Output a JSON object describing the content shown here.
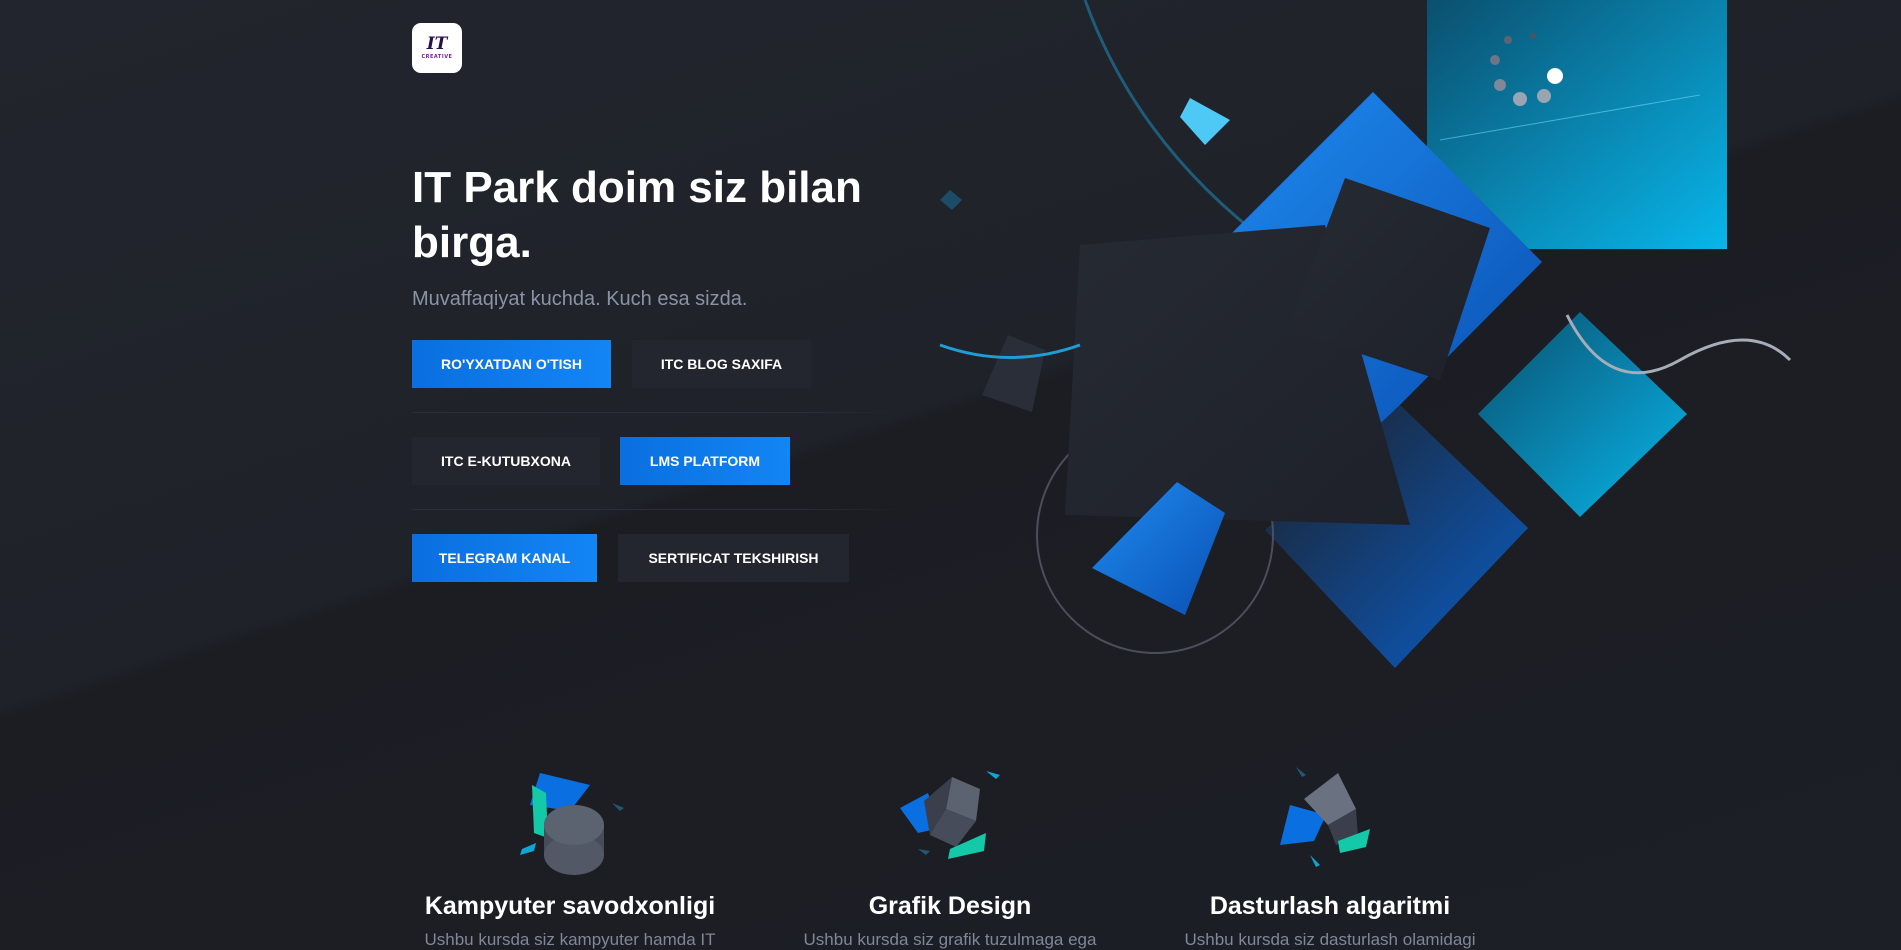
{
  "logo": {
    "mark": "IT",
    "word": "CREATIVE"
  },
  "hero": {
    "title": "IT Park doim siz bilan birga.",
    "subtitle": "Muvaffaqiyat kuchda. Kuch esa sizda."
  },
  "buttons": {
    "register": "RO'YXATDAN O'TISH",
    "blog": "ITC BLOG SAXIFA",
    "library": "ITC E-KUTUBXONA",
    "lms": "LMS PLATFORM",
    "telegram": "TELEGRAM KANAL",
    "certificate": "SERTIFICAT TEKSHIRISH"
  },
  "courses": [
    {
      "title": "Kampyuter savodxonligi",
      "desc": "Ushbu kursda siz kampyuter hamda IT",
      "icon": "cylinder-icon"
    },
    {
      "title": "Grafik Design",
      "desc": "Ushbu kursda siz grafik tuzulmaga ega",
      "icon": "cube-icon"
    },
    {
      "title": "Dasturlash algaritmi",
      "desc": "Ushbu kursda siz dasturlash olamidagi",
      "icon": "prism-icon"
    }
  ],
  "colors": {
    "primary": "#0a78ee",
    "background": "#1d1f26",
    "button_dark": "#23262f",
    "muted_text": "#8a93a6"
  }
}
